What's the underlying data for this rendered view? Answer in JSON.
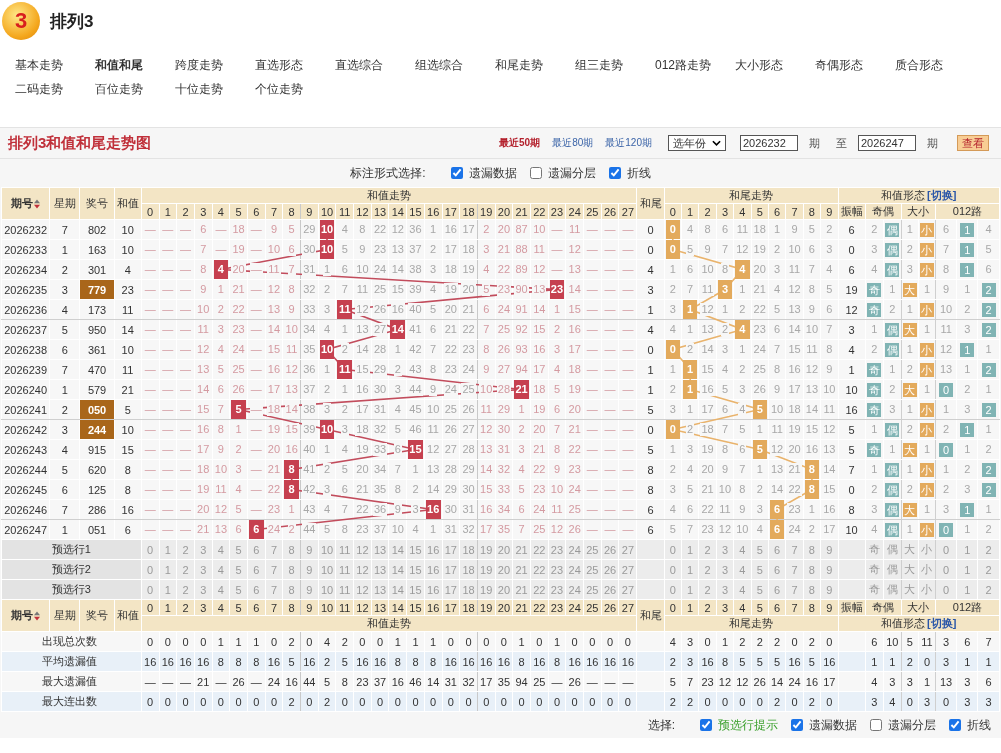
{
  "header": {
    "logo_text": "3",
    "title": "排列3"
  },
  "nav": [
    {
      "label": "基本走势",
      "selected": false
    },
    {
      "label": "和值和尾",
      "selected": true
    },
    {
      "label": "跨度走势",
      "selected": false
    },
    {
      "label": "直选形态",
      "selected": false
    },
    {
      "label": "直选综合",
      "selected": false
    },
    {
      "label": "组选综合",
      "selected": false
    },
    {
      "label": "和尾走势",
      "selected": false
    },
    {
      "label": "组三走势",
      "selected": false
    },
    {
      "label": "012路走势",
      "selected": false
    },
    {
      "label": "大小形态",
      "selected": false
    },
    {
      "label": "奇偶形态",
      "selected": false
    },
    {
      "label": "质合形态",
      "selected": false
    },
    {
      "label": "二码走势",
      "selected": false
    },
    {
      "label": "百位走势",
      "selected": false
    },
    {
      "label": "十位走势",
      "selected": false
    },
    {
      "label": "个位走势",
      "selected": false
    }
  ],
  "chart": {
    "title": "排列3和值和尾走势图",
    "ranges": [
      {
        "label": "最近50期",
        "selected": true
      },
      {
        "label": "最近80期",
        "selected": false
      },
      {
        "label": "最近120期",
        "selected": false
      }
    ],
    "year_select": "选年份",
    "from": "2026232",
    "from_unit": "期",
    "to_label": "至",
    "to": "2026247",
    "to_unit": "期",
    "view_button": "查看"
  },
  "top_options": {
    "label": "标注形式选择:",
    "items": [
      {
        "kind": "omission",
        "label": "遗漏数据",
        "checked": true
      },
      {
        "kind": "layers",
        "label": "遗漏分层",
        "checked": false
      },
      {
        "kind": "line",
        "label": "折线",
        "checked": true
      }
    ]
  },
  "table": {
    "header": {
      "period": "期号",
      "weekday": "星期",
      "number": "奖号",
      "sum": "和值",
      "sum_group": "和值走势",
      "tail": "和尾",
      "tail_group": "和尾走势",
      "form_group": "和值形态",
      "form_switch": "[切换]",
      "sum_columns": [
        "0",
        "1",
        "2",
        "3",
        "4",
        "5",
        "6",
        "7",
        "8",
        "9",
        "10",
        "11",
        "12",
        "13",
        "14",
        "15",
        "16",
        "17",
        "18",
        "19",
        "20",
        "21",
        "22",
        "23",
        "24",
        "25",
        "26",
        "27"
      ],
      "tail_columns": [
        "0",
        "1",
        "2",
        "3",
        "4",
        "5",
        "6",
        "7",
        "8",
        "9"
      ],
      "amplitude": "振幅",
      "form_columns": [
        "奇偶",
        "大小",
        "012路"
      ]
    },
    "rows": [
      {
        "issue": "2026232",
        "weekday": "7",
        "number": "802",
        "pair": false,
        "sum": "10",
        "sum_cells": [
          "—",
          "—",
          "—",
          "6",
          "—",
          "18",
          "—",
          "9",
          "5",
          "29",
          {
            "text": "10",
            "hit": true
          },
          "4",
          "8",
          "22",
          "12",
          "36",
          "1",
          "16",
          "17",
          "2",
          "20",
          "87",
          "10",
          "—",
          "11",
          "—",
          "—",
          "—"
        ],
        "tail": "0",
        "tail_cells": [
          {
            "text": "0",
            "hit": true
          },
          "4",
          "8",
          "6",
          "11",
          "18",
          "1",
          "9",
          "5",
          "2"
        ],
        "amplitude": "6",
        "form_cells": [
          "2",
          {
            "text": "偶",
            "hit": true
          },
          "1",
          {
            "text": "小",
            "hit": true
          },
          "6",
          {
            "text": "1",
            "hit": true
          },
          "4"
        ]
      },
      {
        "issue": "2026233",
        "weekday": "1",
        "number": "163",
        "pair": false,
        "sum": "10",
        "sum_cells": [
          "—",
          "—",
          "—",
          "7",
          "—",
          "19",
          "—",
          "10",
          "6",
          "30",
          {
            "text": "10",
            "hit": true
          },
          "5",
          "9",
          "23",
          "13",
          "37",
          "2",
          "17",
          "18",
          "3",
          "21",
          "88",
          "11",
          "—",
          "12",
          "—",
          "—",
          "—"
        ],
        "tail": "0",
        "tail_cells": [
          {
            "text": "0",
            "hit": true
          },
          "5",
          "9",
          "7",
          "12",
          "19",
          "2",
          "10",
          "6",
          "3"
        ],
        "amplitude": "0",
        "form_cells": [
          "3",
          {
            "text": "偶",
            "hit": true
          },
          "2",
          {
            "text": "小",
            "hit": true
          },
          "7",
          {
            "text": "1",
            "hit": true
          },
          "5"
        ]
      },
      {
        "issue": "2026234",
        "weekday": "2",
        "number": "301",
        "pair": false,
        "sum": "4",
        "sum_cells": [
          "—",
          "—",
          "—",
          "8",
          {
            "text": "4",
            "hit": true
          },
          "20",
          "—",
          "11",
          "7",
          "31",
          "1",
          "6",
          "10",
          "24",
          "14",
          "38",
          "3",
          "18",
          "19",
          "4",
          "22",
          "89",
          "12",
          "—",
          "13",
          "—",
          "—",
          "—"
        ],
        "tail": "4",
        "tail_cells": [
          "1",
          "6",
          "10",
          "8",
          {
            "text": "4",
            "hit": true
          },
          "20",
          "3",
          "11",
          "7",
          "4"
        ],
        "amplitude": "6",
        "form_cells": [
          "4",
          {
            "text": "偶",
            "hit": true
          },
          "3",
          {
            "text": "小",
            "hit": true
          },
          "8",
          {
            "text": "1",
            "hit": true
          },
          "6"
        ]
      },
      {
        "issue": "2026235",
        "weekday": "3",
        "number": "779",
        "pair": true,
        "sum": "23",
        "sum_cells": [
          "—",
          "—",
          "—",
          "9",
          "1",
          "21",
          "—",
          "12",
          "8",
          "32",
          "2",
          "7",
          "11",
          "25",
          "15",
          "39",
          "4",
          "19",
          "20",
          "5",
          "23",
          "90",
          "13",
          {
            "text": "23",
            "hit": true
          },
          "14",
          "—",
          "—",
          "—"
        ],
        "tail": "3",
        "tail_cells": [
          "2",
          "7",
          "11",
          {
            "text": "3",
            "hit": true
          },
          "1",
          "21",
          "4",
          "12",
          "8",
          "5"
        ],
        "amplitude": "19",
        "form_cells": [
          {
            "text": "奇",
            "hit": true
          },
          "1",
          {
            "text": "大",
            "hit": true
          },
          "1",
          "9",
          "1",
          {
            "text": "2",
            "hit": true
          }
        ]
      },
      {
        "issue": "2026236",
        "weekday": "4",
        "number": "173",
        "pair": false,
        "sum": "11",
        "sum_cells": [
          "—",
          "—",
          "—",
          "10",
          "2",
          "22",
          "—",
          "13",
          "9",
          "33",
          "3",
          {
            "text": "11",
            "hit": true
          },
          "12",
          "26",
          "16",
          "40",
          "5",
          "20",
          "21",
          "6",
          "24",
          "91",
          "14",
          "1",
          "15",
          "—",
          "—",
          "—"
        ],
        "tail": "1",
        "tail_cells": [
          "3",
          {
            "text": "1",
            "hit": true
          },
          "12",
          "1",
          "2",
          "22",
          "5",
          "13",
          "9",
          "6"
        ],
        "amplitude": "12",
        "form_cells": [
          {
            "text": "奇",
            "hit": true
          },
          "2",
          "1",
          {
            "text": "小",
            "hit": true
          },
          "10",
          "2",
          {
            "text": "2",
            "hit": true
          }
        ]
      },
      {
        "issue": "2026237",
        "weekday": "5",
        "number": "950",
        "pair": false,
        "sum": "14",
        "sum_cells": [
          "—",
          "—",
          "—",
          "11",
          "3",
          "23",
          "—",
          "14",
          "10",
          "34",
          "4",
          "1",
          "13",
          "27",
          {
            "text": "14",
            "hit": true
          },
          "41",
          "6",
          "21",
          "22",
          "7",
          "25",
          "92",
          "15",
          "2",
          "16",
          "—",
          "—",
          "—"
        ],
        "tail": "4",
        "tail_cells": [
          "4",
          "1",
          "13",
          "2",
          {
            "text": "4",
            "hit": true
          },
          "23",
          "6",
          "14",
          "10",
          "7"
        ],
        "amplitude": "3",
        "form_cells": [
          "1",
          {
            "text": "偶",
            "hit": true
          },
          {
            "text": "大",
            "hit": true
          },
          "1",
          "11",
          "3",
          {
            "text": "2",
            "hit": true
          }
        ]
      },
      {
        "issue": "2026238",
        "weekday": "6",
        "number": "361",
        "pair": false,
        "sum": "10",
        "sum_cells": [
          "—",
          "—",
          "—",
          "12",
          "4",
          "24",
          "—",
          "15",
          "11",
          "35",
          {
            "text": "10",
            "hit": true
          },
          "2",
          "14",
          "28",
          "1",
          "42",
          "7",
          "22",
          "23",
          "8",
          "26",
          "93",
          "16",
          "3",
          "17",
          "—",
          "—",
          "—"
        ],
        "tail": "0",
        "tail_cells": [
          {
            "text": "0",
            "hit": true
          },
          "2",
          "14",
          "3",
          "1",
          "24",
          "7",
          "15",
          "11",
          "8"
        ],
        "amplitude": "4",
        "form_cells": [
          "2",
          {
            "text": "偶",
            "hit": true
          },
          "1",
          {
            "text": "小",
            "hit": true
          },
          "12",
          {
            "text": "1",
            "hit": true
          },
          "1"
        ]
      },
      {
        "issue": "2026239",
        "weekday": "7",
        "number": "470",
        "pair": false,
        "sum": "11",
        "sum_cells": [
          "—",
          "—",
          "—",
          "13",
          "5",
          "25",
          "—",
          "16",
          "12",
          "36",
          "1",
          {
            "text": "11",
            "hit": true
          },
          "15",
          "29",
          "2",
          "43",
          "8",
          "23",
          "24",
          "9",
          "27",
          "94",
          "17",
          "4",
          "18",
          "—",
          "—",
          "—"
        ],
        "tail": "1",
        "tail_cells": [
          "1",
          {
            "text": "1",
            "hit": true
          },
          "15",
          "4",
          "2",
          "25",
          "8",
          "16",
          "12",
          "9"
        ],
        "amplitude": "1",
        "form_cells": [
          {
            "text": "奇",
            "hit": true
          },
          "1",
          "2",
          {
            "text": "小",
            "hit": true
          },
          "13",
          "1",
          {
            "text": "2",
            "hit": true
          }
        ]
      },
      {
        "issue": "2026240",
        "weekday": "1",
        "number": "579",
        "pair": false,
        "sum": "21",
        "sum_cells": [
          "—",
          "—",
          "—",
          "14",
          "6",
          "26",
          "—",
          "17",
          "13",
          "37",
          "2",
          "1",
          "16",
          "30",
          "3",
          "44",
          "9",
          "24",
          "25",
          "10",
          "28",
          {
            "text": "21",
            "hit": true
          },
          "18",
          "5",
          "19",
          "—",
          "—",
          "—"
        ],
        "tail": "1",
        "tail_cells": [
          "2",
          {
            "text": "1",
            "hit": true
          },
          "16",
          "5",
          "3",
          "26",
          "9",
          "17",
          "13",
          "10"
        ],
        "amplitude": "10",
        "form_cells": [
          {
            "text": "奇",
            "hit": true
          },
          "2",
          {
            "text": "大",
            "hit": true
          },
          "1",
          {
            "text": "0",
            "hit": true
          },
          "2",
          "1"
        ]
      },
      {
        "issue": "2026241",
        "weekday": "2",
        "number": "050",
        "pair": true,
        "sum": "5",
        "sum_cells": [
          "—",
          "—",
          "—",
          "15",
          "7",
          {
            "text": "5",
            "hit": true
          },
          "—",
          "18",
          "14",
          "38",
          "3",
          "2",
          "17",
          "31",
          "4",
          "45",
          "10",
          "25",
          "26",
          "11",
          "29",
          "1",
          "19",
          "6",
          "20",
          "—",
          "—",
          "—"
        ],
        "tail": "5",
        "tail_cells": [
          "3",
          "1",
          "17",
          "6",
          "4",
          {
            "text": "5",
            "hit": true
          },
          "10",
          "18",
          "14",
          "11"
        ],
        "amplitude": "16",
        "form_cells": [
          {
            "text": "奇",
            "hit": true
          },
          "3",
          "1",
          {
            "text": "小",
            "hit": true
          },
          "1",
          "3",
          {
            "text": "2",
            "hit": true
          }
        ]
      },
      {
        "issue": "2026242",
        "weekday": "3",
        "number": "244",
        "pair": true,
        "sum": "10",
        "sum_cells": [
          "—",
          "—",
          "—",
          "16",
          "8",
          "1",
          "—",
          "19",
          "15",
          "39",
          {
            "text": "10",
            "hit": true
          },
          "3",
          "18",
          "32",
          "5",
          "46",
          "11",
          "26",
          "27",
          "12",
          "30",
          "2",
          "20",
          "7",
          "21",
          "—",
          "—",
          "—"
        ],
        "tail": "0",
        "tail_cells": [
          {
            "text": "0",
            "hit": true
          },
          "2",
          "18",
          "7",
          "5",
          "1",
          "11",
          "19",
          "15",
          "12"
        ],
        "amplitude": "5",
        "form_cells": [
          "1",
          {
            "text": "偶",
            "hit": true
          },
          "2",
          {
            "text": "小",
            "hit": true
          },
          "2",
          {
            "text": "1",
            "hit": true
          },
          "1"
        ]
      },
      {
        "issue": "2026243",
        "weekday": "4",
        "number": "915",
        "pair": false,
        "sum": "15",
        "sum_cells": [
          "—",
          "—",
          "—",
          "17",
          "9",
          "2",
          "—",
          "20",
          "16",
          "40",
          "1",
          "4",
          "19",
          "33",
          "6",
          {
            "text": "15",
            "hit": true
          },
          "12",
          "27",
          "28",
          "13",
          "31",
          "3",
          "21",
          "8",
          "22",
          "—",
          "—",
          "—"
        ],
        "tail": "5",
        "tail_cells": [
          "1",
          "3",
          "19",
          "8",
          "6",
          {
            "text": "5",
            "hit": true
          },
          "12",
          "20",
          "16",
          "13"
        ],
        "amplitude": "5",
        "form_cells": [
          {
            "text": "奇",
            "hit": true
          },
          "1",
          {
            "text": "大",
            "hit": true
          },
          "1",
          {
            "text": "0",
            "hit": true
          },
          "1",
          "2"
        ]
      },
      {
        "issue": "2026244",
        "weekday": "5",
        "number": "620",
        "pair": false,
        "sum": "8",
        "sum_cells": [
          "—",
          "—",
          "—",
          "18",
          "10",
          "3",
          "—",
          "21",
          {
            "text": "8",
            "hit": true
          },
          "41",
          "2",
          "5",
          "20",
          "34",
          "7",
          "1",
          "13",
          "28",
          "29",
          "14",
          "32",
          "4",
          "22",
          "9",
          "23",
          "—",
          "—",
          "—"
        ],
        "tail": "8",
        "tail_cells": [
          "2",
          "4",
          "20",
          "9",
          "7",
          "1",
          "13",
          "21",
          {
            "text": "8",
            "hit": true
          },
          "14"
        ],
        "amplitude": "7",
        "form_cells": [
          "1",
          {
            "text": "偶",
            "hit": true
          },
          "1",
          {
            "text": "小",
            "hit": true
          },
          "1",
          "2",
          {
            "text": "2",
            "hit": true
          }
        ]
      },
      {
        "issue": "2026245",
        "weekday": "6",
        "number": "125",
        "pair": false,
        "sum": "8",
        "sum_cells": [
          "—",
          "—",
          "—",
          "19",
          "11",
          "4",
          "—",
          "22",
          {
            "text": "8",
            "hit": true
          },
          "42",
          "3",
          "6",
          "21",
          "35",
          "8",
          "2",
          "14",
          "29",
          "30",
          "15",
          "33",
          "5",
          "23",
          "10",
          "24",
          "—",
          "—",
          "—"
        ],
        "tail": "8",
        "tail_cells": [
          "3",
          "5",
          "21",
          "10",
          "8",
          "2",
          "14",
          "22",
          {
            "text": "8",
            "hit": true
          },
          "15"
        ],
        "amplitude": "0",
        "form_cells": [
          "2",
          {
            "text": "偶",
            "hit": true
          },
          "2",
          {
            "text": "小",
            "hit": true
          },
          "2",
          "3",
          {
            "text": "2",
            "hit": true
          }
        ]
      },
      {
        "issue": "2026246",
        "weekday": "7",
        "number": "286",
        "pair": false,
        "sum": "16",
        "sum_cells": [
          "—",
          "—",
          "—",
          "20",
          "12",
          "5",
          "—",
          "23",
          "1",
          "43",
          "4",
          "7",
          "22",
          "36",
          "9",
          "3",
          {
            "text": "16",
            "hit": true
          },
          "30",
          "31",
          "16",
          "34",
          "6",
          "24",
          "11",
          "25",
          "—",
          "—",
          "—"
        ],
        "tail": "6",
        "tail_cells": [
          "4",
          "6",
          "22",
          "11",
          "9",
          "3",
          {
            "text": "6",
            "hit": true
          },
          "23",
          "1",
          "16"
        ],
        "amplitude": "8",
        "form_cells": [
          "3",
          {
            "text": "偶",
            "hit": true
          },
          {
            "text": "大",
            "hit": true
          },
          "1",
          "3",
          {
            "text": "1",
            "hit": true
          },
          "1"
        ]
      },
      {
        "issue": "2026247",
        "weekday": "1",
        "number": "051",
        "pair": false,
        "sum": "6",
        "sum_cells": [
          "—",
          "—",
          "—",
          "21",
          "13",
          "6",
          {
            "text": "6",
            "hit": true
          },
          "24",
          "2",
          "44",
          "5",
          "8",
          "23",
          "37",
          "10",
          "4",
          "1",
          "31",
          "32",
          "17",
          "35",
          "7",
          "25",
          "12",
          "26",
          "—",
          "—",
          "—"
        ],
        "tail": "6",
        "tail_cells": [
          "5",
          "7",
          "23",
          "12",
          "10",
          "4",
          {
            "text": "6",
            "hit": true
          },
          "24",
          "2",
          "17"
        ],
        "amplitude": "10",
        "form_cells": [
          "4",
          {
            "text": "偶",
            "hit": true
          },
          "1",
          {
            "text": "小",
            "hit": true
          },
          {
            "text": "0",
            "hit": true
          },
          "1",
          "2"
        ]
      }
    ],
    "preselect_rows": [
      {
        "label": "预选行1",
        "sum_cells": [
          "0",
          "1",
          "2",
          "3",
          "4",
          "5",
          "6",
          "7",
          "8",
          "9",
          "10",
          "11",
          "12",
          "13",
          "14",
          "15",
          "16",
          "17",
          "18",
          "19",
          "20",
          "21",
          "22",
          "23",
          "24",
          "25",
          "26",
          "27"
        ],
        "tail_cells": [
          "0",
          "1",
          "2",
          "3",
          "4",
          "5",
          "6",
          "7",
          "8",
          "9"
        ],
        "form_cells": [
          "奇",
          "偶",
          "大",
          "小",
          "0",
          "1",
          "2"
        ]
      },
      {
        "label": "预选行2",
        "sum_cells": [
          "0",
          "1",
          "2",
          "3",
          "4",
          "5",
          "6",
          "7",
          "8",
          "9",
          "10",
          "11",
          "12",
          "13",
          "14",
          "15",
          "16",
          "17",
          "18",
          "19",
          "20",
          "21",
          "22",
          "23",
          "24",
          "25",
          "26",
          "27"
        ],
        "tail_cells": [
          "0",
          "1",
          "2",
          "3",
          "4",
          "5",
          "6",
          "7",
          "8",
          "9"
        ],
        "form_cells": [
          "奇",
          "偶",
          "大",
          "小",
          "0",
          "1",
          "2"
        ]
      },
      {
        "label": "预选行3",
        "sum_cells": [
          "0",
          "1",
          "2",
          "3",
          "4",
          "5",
          "6",
          "7",
          "8",
          "9",
          "10",
          "11",
          "12",
          "13",
          "14",
          "15",
          "16",
          "17",
          "18",
          "19",
          "20",
          "21",
          "22",
          "23",
          "24",
          "25",
          "26",
          "27"
        ],
        "tail_cells": [
          "0",
          "1",
          "2",
          "3",
          "4",
          "5",
          "6",
          "7",
          "8",
          "9"
        ],
        "form_cells": [
          "奇",
          "偶",
          "大",
          "小",
          "0",
          "1",
          "2"
        ]
      }
    ],
    "footer_header": {
      "period": "期号",
      "weekday": "星期",
      "number": "奖号",
      "sum": "和值",
      "sum_group": "和值走势",
      "tail": "和尾",
      "tail_group": "和尾走势",
      "form_group": "和值形态",
      "form_switch": "[切换]",
      "sum_columns": [
        "0",
        "1",
        "2",
        "3",
        "4",
        "5",
        "6",
        "7",
        "8",
        "9",
        "10",
        "11",
        "12",
        "13",
        "14",
        "15",
        "16",
        "17",
        "18",
        "19",
        "20",
        "21",
        "22",
        "23",
        "24",
        "25",
        "26",
        "27"
      ],
      "tail_columns": [
        "0",
        "1",
        "2",
        "3",
        "4",
        "5",
        "6",
        "7",
        "8",
        "9"
      ],
      "amplitude": "振幅",
      "form_columns": [
        "奇偶",
        "大小",
        "012路"
      ]
    },
    "stats": [
      {
        "label": "出现总次数",
        "sum_cells": [
          "0",
          "0",
          "0",
          "0",
          "1",
          "1",
          "1",
          "0",
          "2",
          "0",
          "4",
          "2",
          "0",
          "0",
          "1",
          "1",
          "1",
          "0",
          "0",
          "0",
          "0",
          "1",
          "0",
          "1",
          "0",
          "0",
          "0",
          "0"
        ],
        "tail_cells": [
          "4",
          "3",
          "0",
          "1",
          "2",
          "2",
          "2",
          "0",
          "2",
          "0"
        ],
        "form_cells": [
          "6",
          "10",
          "5",
          "11",
          "3",
          "6",
          "7"
        ]
      },
      {
        "label": "平均遗漏值",
        "sum_cells": [
          "16",
          "16",
          "16",
          "16",
          "8",
          "8",
          "8",
          "16",
          "5",
          "16",
          "2",
          "5",
          "16",
          "16",
          "8",
          "8",
          "8",
          "16",
          "16",
          "16",
          "16",
          "8",
          "16",
          "8",
          "16",
          "16",
          "16",
          "16"
        ],
        "tail_cells": [
          "2",
          "3",
          "16",
          "8",
          "5",
          "5",
          "5",
          "16",
          "5",
          "16"
        ],
        "form_cells": [
          "1",
          "1",
          "2",
          "0",
          "3",
          "1",
          "1"
        ]
      },
      {
        "label": "最大遗漏值",
        "sum_cells": [
          "—",
          "—",
          "—",
          "21",
          "—",
          "26",
          "—",
          "24",
          "16",
          "44",
          "5",
          "8",
          "23",
          "37",
          "16",
          "46",
          "14",
          "31",
          "32",
          "17",
          "35",
          "94",
          "25",
          "—",
          "26",
          "—",
          "—",
          "—"
        ],
        "tail_cells": [
          "5",
          "7",
          "23",
          "12",
          "12",
          "26",
          "14",
          "24",
          "16",
          "17"
        ],
        "form_cells": [
          "4",
          "3",
          "3",
          "1",
          "13",
          "3",
          "6"
        ]
      },
      {
        "label": "最大连出数",
        "sum_cells": [
          "0",
          "0",
          "0",
          "0",
          "0",
          "0",
          "0",
          "0",
          "2",
          "0",
          "2",
          "0",
          "0",
          "0",
          "0",
          "0",
          "0",
          "0",
          "0",
          "0",
          "0",
          "0",
          "0",
          "0",
          "0",
          "0",
          "0",
          "0"
        ],
        "tail_cells": [
          "2",
          "2",
          "0",
          "0",
          "0",
          "0",
          "2",
          "0",
          "2",
          "0"
        ],
        "form_cells": [
          "3",
          "4",
          "0",
          "3",
          "0",
          "3",
          "3"
        ]
      }
    ]
  },
  "bottom_options": {
    "label": "选择:",
    "items": [
      {
        "kind": "hint",
        "label": "预选行提示",
        "checked": true
      },
      {
        "kind": "omission",
        "label": "遗漏数据",
        "checked": true
      },
      {
        "kind": "layers",
        "label": "遗漏分层",
        "checked": false
      },
      {
        "kind": "line",
        "label": "折线",
        "checked": true
      }
    ]
  }
}
